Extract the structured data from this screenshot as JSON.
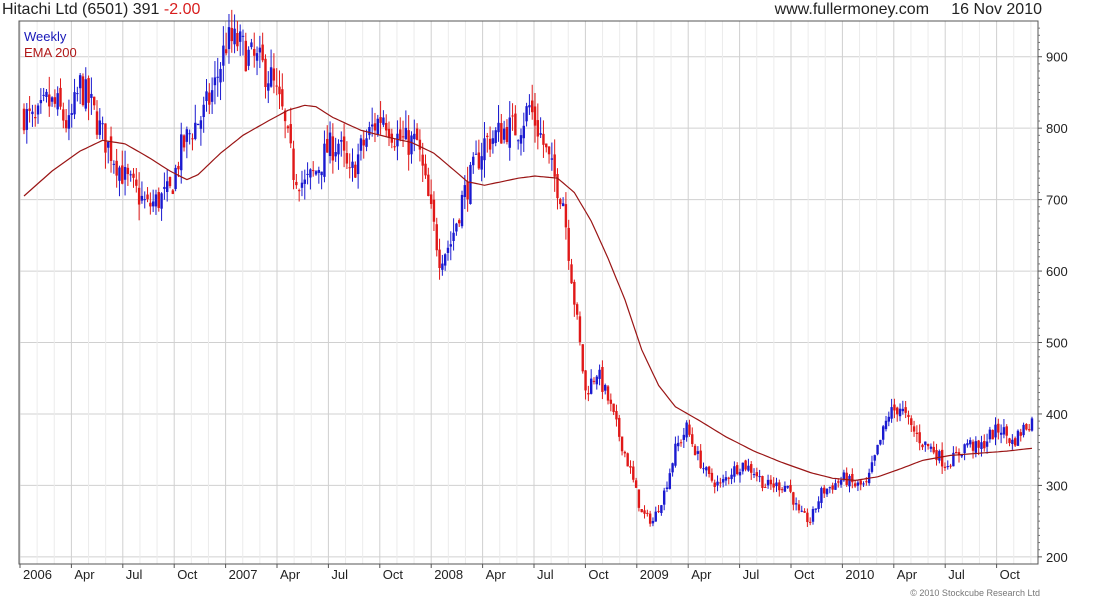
{
  "header": {
    "security": "Hitachi Ltd (6501)",
    "last": "391",
    "change": "-2.00",
    "source": "www.fullermoney.com",
    "date": "16 Nov 2010"
  },
  "footer": {
    "copyright": "© 2010 Stockcube Research Ltd"
  },
  "colors": {
    "up": "#1a1ad0",
    "down": "#e01818",
    "ema": "#9a1515",
    "grid": "#d0d0d0"
  },
  "chart_data": {
    "type": "candlestick",
    "title": "Hitachi Ltd (6501) 391 -2.00",
    "ylim": [
      190,
      950
    ],
    "yticks": [
      200,
      300,
      400,
      500,
      600,
      700,
      800,
      900
    ],
    "xticks": [
      "2006",
      "Apr",
      "Jul",
      "Oct",
      "2007",
      "Apr",
      "Jul",
      "Oct",
      "2008",
      "Apr",
      "Jul",
      "Oct",
      "2009",
      "Apr",
      "Jul",
      "Oct",
      "2010",
      "Apr",
      "Jul",
      "Oct"
    ],
    "grid": true,
    "legend": "top-left",
    "series": [
      {
        "name": "Weekly",
        "kind": "price",
        "keypoints": [
          [
            0,
            820
          ],
          [
            4,
            805
          ],
          [
            8,
            835
          ],
          [
            12,
            830
          ],
          [
            16,
            800
          ],
          [
            20,
            860
          ],
          [
            24,
            830
          ],
          [
            28,
            790
          ],
          [
            32,
            760
          ],
          [
            36,
            730
          ],
          [
            40,
            710
          ],
          [
            44,
            690
          ],
          [
            48,
            700
          ],
          [
            52,
            710
          ],
          [
            56,
            770
          ],
          [
            60,
            800
          ],
          [
            64,
            820
          ],
          [
            68,
            860
          ],
          [
            72,
            920
          ],
          [
            76,
            920
          ],
          [
            80,
            900
          ],
          [
            84,
            890
          ],
          [
            88,
            870
          ],
          [
            92,
            820
          ],
          [
            96,
            740
          ],
          [
            100,
            720
          ],
          [
            104,
            740
          ],
          [
            108,
            770
          ],
          [
            112,
            780
          ],
          [
            116,
            730
          ],
          [
            120,
            770
          ],
          [
            124,
            800
          ],
          [
            128,
            820
          ],
          [
            132,
            790
          ],
          [
            136,
            780
          ],
          [
            140,
            780
          ],
          [
            144,
            700
          ],
          [
            148,
            620
          ],
          [
            152,
            640
          ],
          [
            156,
            700
          ],
          [
            160,
            740
          ],
          [
            164,
            780
          ],
          [
            168,
            790
          ],
          [
            172,
            800
          ],
          [
            176,
            800
          ],
          [
            180,
            830
          ],
          [
            184,
            790
          ],
          [
            188,
            740
          ],
          [
            192,
            700
          ],
          [
            196,
            560
          ],
          [
            200,
            430
          ],
          [
            204,
            460
          ],
          [
            208,
            420
          ],
          [
            212,
            370
          ],
          [
            216,
            320
          ],
          [
            220,
            260
          ],
          [
            224,
            250
          ],
          [
            228,
            290
          ],
          [
            232,
            350
          ],
          [
            236,
            380
          ],
          [
            240,
            340
          ],
          [
            244,
            310
          ],
          [
            248,
            300
          ],
          [
            252,
            320
          ],
          [
            256,
            330
          ],
          [
            260,
            320
          ],
          [
            264,
            300
          ],
          [
            268,
            300
          ],
          [
            272,
            300
          ],
          [
            276,
            260
          ],
          [
            280,
            250
          ],
          [
            284,
            290
          ],
          [
            288,
            300
          ],
          [
            292,
            310
          ],
          [
            296,
            300
          ],
          [
            300,
            300
          ],
          [
            304,
            350
          ],
          [
            308,
            400
          ],
          [
            312,
            410
          ],
          [
            316,
            380
          ],
          [
            320,
            360
          ],
          [
            324,
            350
          ],
          [
            328,
            330
          ],
          [
            332,
            340
          ],
          [
            336,
            360
          ],
          [
            340,
            350
          ],
          [
            344,
            370
          ],
          [
            348,
            380
          ],
          [
            352,
            360
          ],
          [
            356,
            380
          ],
          [
            359,
            391
          ]
        ]
      },
      {
        "name": "EMA 200",
        "kind": "ema",
        "keypoints": [
          [
            0,
            705
          ],
          [
            10,
            740
          ],
          [
            20,
            768
          ],
          [
            28,
            783
          ],
          [
            36,
            778
          ],
          [
            44,
            760
          ],
          [
            52,
            740
          ],
          [
            58,
            728
          ],
          [
            62,
            735
          ],
          [
            70,
            765
          ],
          [
            78,
            790
          ],
          [
            86,
            808
          ],
          [
            94,
            825
          ],
          [
            100,
            832
          ],
          [
            104,
            830
          ],
          [
            110,
            815
          ],
          [
            120,
            797
          ],
          [
            130,
            787
          ],
          [
            138,
            780
          ],
          [
            146,
            765
          ],
          [
            152,
            745
          ],
          [
            158,
            725
          ],
          [
            164,
            720
          ],
          [
            170,
            725
          ],
          [
            176,
            730
          ],
          [
            182,
            733
          ],
          [
            190,
            730
          ],
          [
            196,
            710
          ],
          [
            202,
            670
          ],
          [
            208,
            618
          ],
          [
            214,
            560
          ],
          [
            220,
            490
          ],
          [
            226,
            440
          ],
          [
            232,
            410
          ],
          [
            240,
            392
          ],
          [
            250,
            368
          ],
          [
            260,
            348
          ],
          [
            270,
            332
          ],
          [
            280,
            318
          ],
          [
            288,
            310
          ],
          [
            296,
            307
          ],
          [
            304,
            312
          ],
          [
            312,
            323
          ],
          [
            320,
            335
          ],
          [
            330,
            342
          ],
          [
            340,
            345
          ],
          [
            350,
            348
          ],
          [
            359,
            352
          ]
        ]
      }
    ]
  }
}
